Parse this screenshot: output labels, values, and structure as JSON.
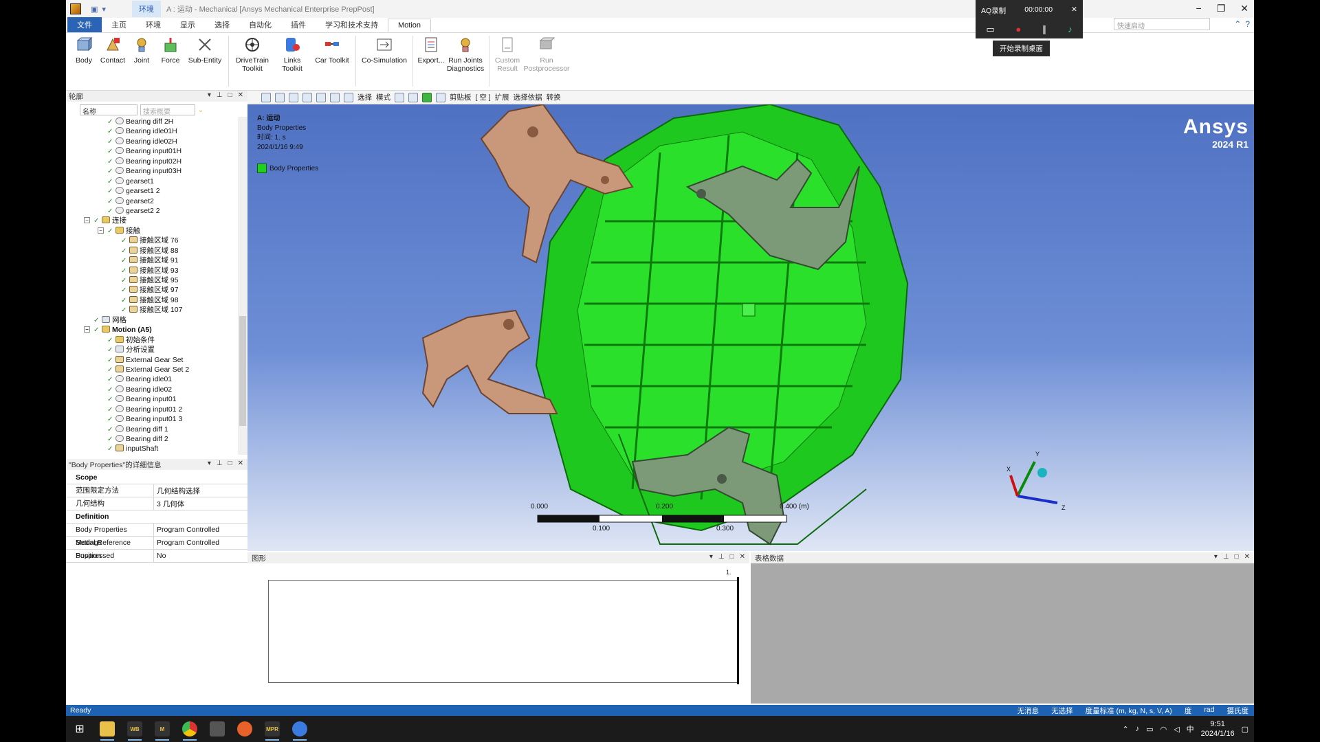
{
  "window": {
    "context_tab": "环境",
    "title": "A : 运动 - Mechanical [Ansys Mechanical Enterprise PrepPost]",
    "controls": [
      "−",
      "❐",
      "✕"
    ]
  },
  "ribbon_tabs": [
    {
      "label": "文件"
    },
    {
      "label": "主页"
    },
    {
      "label": "环境"
    },
    {
      "label": "显示"
    },
    {
      "label": "选择"
    },
    {
      "label": "自动化"
    },
    {
      "label": "插件"
    },
    {
      "label": "学习和技术支持"
    },
    {
      "label": "Motion"
    }
  ],
  "quick_search": {
    "placeholder": "快速启动"
  },
  "ribbon_buttons": [
    {
      "label": "Body",
      "icon": "body-icon",
      "color": "#6f8fb8"
    },
    {
      "label": "Contact",
      "icon": "contact-icon",
      "color": "#d9a84a"
    },
    {
      "label": "Joint",
      "icon": "joint-icon",
      "color": "#e2b23c"
    },
    {
      "label": "Force",
      "icon": "force-icon",
      "color": "#d33"
    },
    {
      "label": "Sub-Entity",
      "icon": "sub-entity-icon",
      "color": "#555"
    },
    {
      "label": "DriveTrain Toolkit",
      "icon": "drivetrain-icon",
      "color": "#333"
    },
    {
      "label": "Links Toolkit",
      "icon": "links-icon",
      "color": "#2b64b5"
    },
    {
      "label": "Car Toolkit",
      "icon": "car-icon",
      "color": "#d33"
    },
    {
      "label": "Co-Simulation",
      "icon": "cosim-icon",
      "color": "#444"
    },
    {
      "label": "Export...",
      "icon": "export-icon",
      "color": "#444"
    },
    {
      "label": "Run Joints Diagnostics",
      "icon": "diagnostics-icon",
      "color": "#e2b23c"
    },
    {
      "label": "Custom Result",
      "icon": "custom-result-icon",
      "color": "#999"
    },
    {
      "label": "Run Postprocessor",
      "icon": "postprocessor-icon",
      "color": "#999"
    }
  ],
  "toolbar2": {
    "select": "选择",
    "mode": "模式",
    "clipboard": "剪贴板",
    "bracket": "[ 空 ]",
    "extend": "扩展",
    "select_by": "选择依据",
    "convert": "转换"
  },
  "outline": {
    "title": "轮廓",
    "filter_select": "名称",
    "search_placeholder": "搜索概要",
    "rows": [
      {
        "label": "Bearing diff 2H",
        "indent": 2,
        "icon": "joint"
      },
      {
        "label": "Bearing idle01H",
        "indent": 2,
        "icon": "joint"
      },
      {
        "label": "Bearing idle02H",
        "indent": 2,
        "icon": "joint"
      },
      {
        "label": "Bearing input01H",
        "indent": 2,
        "icon": "joint"
      },
      {
        "label": "Bearing input02H",
        "indent": 2,
        "icon": "joint"
      },
      {
        "label": "Bearing input03H",
        "indent": 2,
        "icon": "joint"
      },
      {
        "label": "gearset1",
        "indent": 2,
        "icon": "joint"
      },
      {
        "label": "gearset1 2",
        "indent": 2,
        "icon": "joint"
      },
      {
        "label": "gearset2",
        "indent": 2,
        "icon": "joint"
      },
      {
        "label": "gearset2 2",
        "indent": 2,
        "icon": "joint"
      },
      {
        "label": "连接",
        "indent": 1,
        "icon": "folder",
        "expander": "−"
      },
      {
        "label": "接触",
        "indent": 2,
        "icon": "folder",
        "expander": "−"
      },
      {
        "label": "接触区域 76",
        "indent": 3,
        "icon": "contact"
      },
      {
        "label": "接触区域 88",
        "indent": 3,
        "icon": "contact"
      },
      {
        "label": "接触区域 91",
        "indent": 3,
        "icon": "contact"
      },
      {
        "label": "接触区域 93",
        "indent": 3,
        "icon": "contact"
      },
      {
        "label": "接触区域 95",
        "indent": 3,
        "icon": "contact"
      },
      {
        "label": "接触区域 97",
        "indent": 3,
        "icon": "contact"
      },
      {
        "label": "接触区域 98",
        "indent": 3,
        "icon": "contact"
      },
      {
        "label": "接触区域 107",
        "indent": 3,
        "icon": "contact"
      },
      {
        "label": "网格",
        "indent": 1,
        "icon": "plain"
      },
      {
        "label": "Motion (A5)",
        "indent": 1,
        "icon": "folder",
        "expander": "−",
        "bold": true
      },
      {
        "label": "初始条件",
        "indent": 2,
        "icon": "folder"
      },
      {
        "label": "分析设置",
        "indent": 2,
        "icon": "plain"
      },
      {
        "label": "External Gear Set",
        "indent": 2,
        "icon": "contact"
      },
      {
        "label": "External Gear Set 2",
        "indent": 2,
        "icon": "contact"
      },
      {
        "label": "Bearing idle01",
        "indent": 2,
        "icon": "joint"
      },
      {
        "label": "Bearing idle02",
        "indent": 2,
        "icon": "joint"
      },
      {
        "label": "Bearing input01",
        "indent": 2,
        "icon": "joint"
      },
      {
        "label": "Bearing input01 2",
        "indent": 2,
        "icon": "joint"
      },
      {
        "label": "Bearing input01 3",
        "indent": 2,
        "icon": "joint"
      },
      {
        "label": "Bearing diff 1",
        "indent": 2,
        "icon": "joint"
      },
      {
        "label": "Bearing diff 2",
        "indent": 2,
        "icon": "joint"
      },
      {
        "label": "inputShaft",
        "indent": 2,
        "icon": "contact"
      }
    ]
  },
  "details": {
    "title": "\"Body Properties\"的详细信息",
    "sections": [
      {
        "name": "Scope",
        "rows": [
          {
            "k": "范围限定方法",
            "v": "几何结构选择"
          },
          {
            "k": "几何结构",
            "v": "3 几何体"
          }
        ]
      },
      {
        "name": "Definition",
        "rows": [
          {
            "k": "Body Properties Settings",
            "v": "Program Controlled"
          },
          {
            "k": "Modal Reference Position",
            "v": "Program Controlled"
          },
          {
            "k": "Suppressed",
            "v": "No"
          }
        ]
      }
    ]
  },
  "viewport": {
    "title": "A: 运动",
    "subtitle": "Body Properties",
    "time": "时间: 1. s",
    "date": "2024/1/16 9:49",
    "legend": "Body Properties",
    "brand": "Ansys",
    "version": "2024 R1",
    "scale_top": [
      "0.000",
      "0.200",
      "0.400 (m)"
    ],
    "scale_bottom": [
      "0.100",
      "0.300"
    ],
    "axes": {
      "x": "X",
      "y": "Y",
      "z": "Z"
    },
    "colors": {
      "housing": "#1fd11f",
      "bracket_copper": "#c9977a",
      "bracket_grey": "#7d9a78"
    }
  },
  "graph": {
    "title": "图形",
    "label": "1."
  },
  "tabular": {
    "title": "表格数据"
  },
  "status": {
    "left": "Ready",
    "messages": "无消息",
    "selection": "无选择",
    "units": "度量标准 (m, kg, N, s, V, A)",
    "deg": "度",
    "rad": "rad",
    "temp": "摄氏度"
  },
  "recorder": {
    "name": "AQ录制",
    "time": "00:00:00",
    "tooltip": "开始录制桌面"
  },
  "taskbar": {
    "apps": [
      {
        "name": "start",
        "label": ""
      },
      {
        "name": "explorer",
        "label": ""
      },
      {
        "name": "workbench",
        "label": "WB"
      },
      {
        "name": "mechanical",
        "label": "M"
      },
      {
        "name": "chrome",
        "label": ""
      },
      {
        "name": "app5",
        "label": ""
      },
      {
        "name": "mic",
        "label": ""
      },
      {
        "name": "mpr",
        "label": "MPR"
      },
      {
        "name": "app8",
        "label": ""
      }
    ],
    "ime": "中",
    "time": "9:51",
    "date": "2024/1/16"
  }
}
